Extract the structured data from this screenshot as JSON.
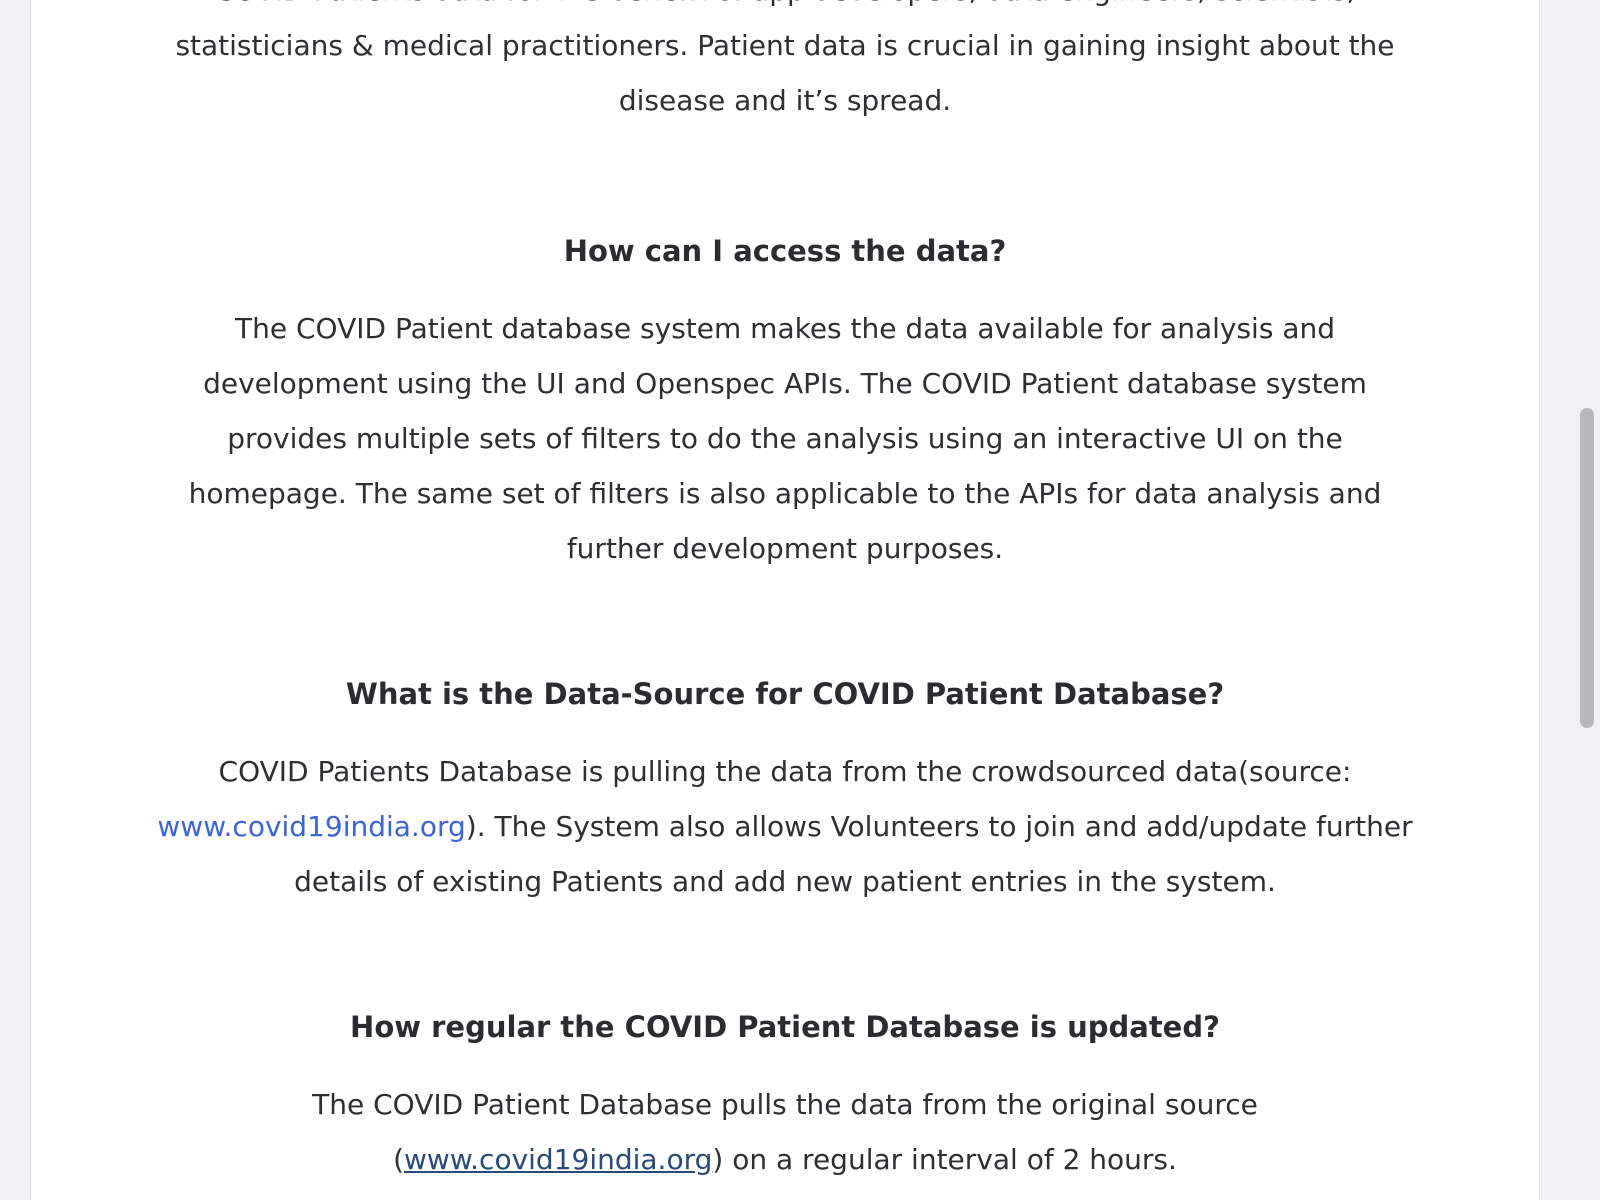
{
  "sections": {
    "intro": {
      "line_partial": "COVID Patients data for the benefit of app developers, data engineers, scientists,",
      "line1": "statisticians & medical practitioners. Patient data is crucial in gaining insight about the",
      "line2": "disease and it’s spread."
    },
    "access": {
      "heading": "How can I access the data?",
      "line1": "The COVID Patient database system makes the data available for analysis and",
      "line2": "development using the UI and Openspec APIs. The COVID Patient database system",
      "line3": "provides multiple sets of filters to do the analysis using an interactive UI on the",
      "line4": "homepage. The same set of filters is also applicable to the APIs for data analysis and",
      "line5": "further development purposes."
    },
    "source": {
      "heading": "What is the Data-Source for COVID Patient Database?",
      "line1": "COVID Patients Database is pulling the data from the crowdsourced data(source:",
      "link": "www.covid19india.org",
      "line2_rest": "). The System also allows Volunteers to join and add/update further",
      "line3": "details of existing Patients and add new patient entries in the system."
    },
    "update": {
      "heading": "How regular the COVID Patient Database is updated?",
      "line1": "The COVID Patient Database pulls the data from the original source",
      "line2_open": "(",
      "link": "www.covid19india.org",
      "line2_rest": ") on a regular interval of 2 hours."
    }
  },
  "colors": {
    "text": "#2f2f33",
    "link": "#3b64d6",
    "link_underlined": "#2a4a7a",
    "background": "#ffffff"
  }
}
